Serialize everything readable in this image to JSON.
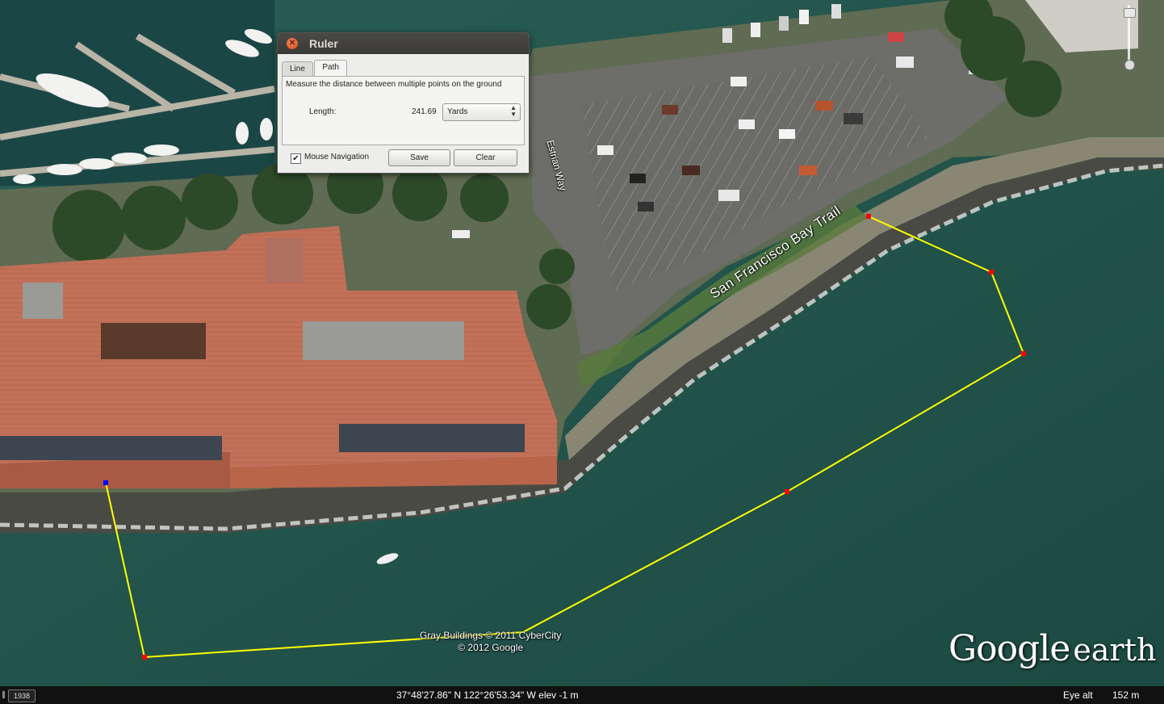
{
  "ruler": {
    "title": "Ruler",
    "close_icon": "close-icon",
    "tabs": [
      "Line",
      "Path"
    ],
    "active_tab": "Path",
    "description": "Measure the distance between multiple points on the ground",
    "length_label": "Length:",
    "length_value": "241.69",
    "unit": "Yards",
    "mouse_navigation_label": "Mouse Navigation",
    "mouse_navigation_checked": true,
    "save_label": "Save",
    "clear_label": "Clear"
  },
  "map": {
    "road_labels": [
      "San Francisco Bay Trail",
      "Estrian Way"
    ],
    "attribution_line1": "Gray Buildings © 2011 CyberCity",
    "attribution_line2": "© 2012 Google",
    "logo_google": "Google",
    "logo_earth": "earth",
    "path_color": "#ffff00",
    "point_color": "#ff0000",
    "start_point_color": "#0000ff"
  },
  "statusbar": {
    "year": "1938",
    "coordinates": "37°48'27.86\" N  122°26'53.34\" W  elev    -1 m",
    "eye_alt_label": "Eye alt",
    "eye_alt_value": "152 m"
  }
}
